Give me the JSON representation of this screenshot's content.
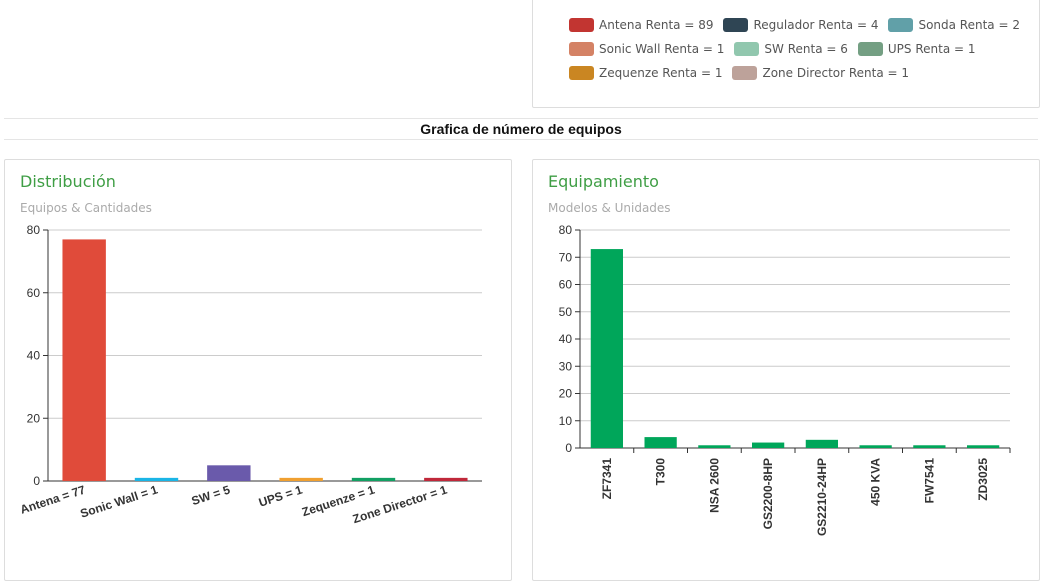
{
  "legend": {
    "rows": [
      [
        {
          "label": "Antena Renta = 89",
          "color": "#c23531"
        },
        {
          "label": "Regulador Renta = 4",
          "color": "#2f4554"
        },
        {
          "label": "Sonda Renta = 2",
          "color": "#61a0a8"
        }
      ],
      [
        {
          "label": "Sonic Wall Renta = 1",
          "color": "#d48265"
        },
        {
          "label": "SW Renta = 6",
          "color": "#91c7ae"
        },
        {
          "label": "UPS Renta = 1",
          "color": "#749f83"
        }
      ],
      [
        {
          "label": "Zequenze Renta = 1",
          "color": "#ca8622"
        },
        {
          "label": "Zone Director Renta = 1",
          "color": "#bda29a"
        }
      ]
    ]
  },
  "section_title": "Grafica de número de equipos",
  "cards": {
    "left": {
      "title": "Distribución",
      "subtitle": "Equipos & Cantidades"
    },
    "right": {
      "title": "Equipamiento",
      "subtitle": "Modelos & Unidades"
    }
  },
  "chart_data": [
    {
      "type": "bar",
      "title": "Distribución",
      "subtitle": "Equipos & Cantidades",
      "categories": [
        "Antena = 77",
        "Sonic Wall = 1",
        "SW = 5",
        "UPS = 1",
        "Zequenze = 1",
        "Zone Director = 1"
      ],
      "values": [
        77,
        1,
        5,
        1,
        1,
        1
      ],
      "colors": [
        "#e04b3a",
        "#1ab5e6",
        "#6a5aab",
        "#f0a030",
        "#12a063",
        "#c0283a"
      ],
      "ylim": [
        0,
        80
      ],
      "yticks": [
        0,
        20,
        40,
        60,
        80
      ],
      "grid": true
    },
    {
      "type": "bar",
      "title": "Equipamiento",
      "subtitle": "Modelos & Unidades",
      "categories": [
        "ZF7341",
        "T300",
        "NSA 2600",
        "GS2200-8HP",
        "GS2210-24HP",
        "450 KVA",
        "FW7541",
        "ZD3025"
      ],
      "values": [
        73,
        4,
        1,
        2,
        3,
        1,
        1,
        1
      ],
      "color": "#00a65a",
      "ylim": [
        0,
        80
      ],
      "yticks": [
        0,
        10,
        20,
        30,
        40,
        50,
        60,
        70,
        80
      ],
      "grid": true
    }
  ]
}
